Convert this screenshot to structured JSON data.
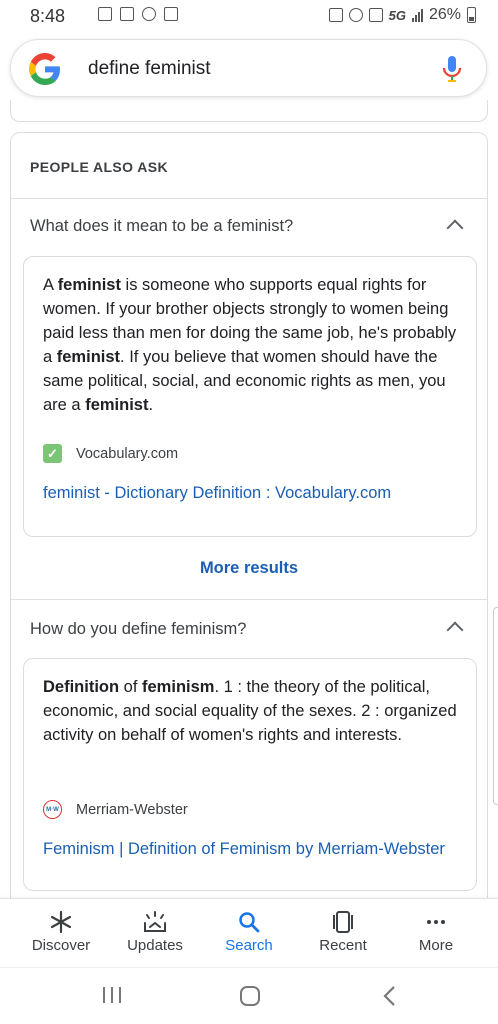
{
  "status_bar": {
    "time": "8:48",
    "network": "5G",
    "battery": "26%"
  },
  "search": {
    "query": "define feminist"
  },
  "paa": {
    "heading": "PEOPLE ALSO ASK",
    "questions": [
      {
        "question": "What does it mean to be a feminist?",
        "answer_parts": [
          {
            "t": "A ",
            "b": false
          },
          {
            "t": "feminist",
            "b": true
          },
          {
            "t": " is someone who supports equal rights for women. If your brother objects strongly to women being paid less than men for doing the same job, he's probably a ",
            "b": false
          },
          {
            "t": "feminist",
            "b": true
          },
          {
            "t": ". If you believe that women should have the same political, social, and economic rights as men, you are a ",
            "b": false
          },
          {
            "t": "feminist",
            "b": true
          },
          {
            "t": ".",
            "b": false
          }
        ],
        "source": "Vocabulary.com",
        "link": "feminist - Dictionary Definition : Vocabulary.com"
      },
      {
        "question": "How do you define feminism?",
        "answer_parts": [
          {
            "t": "Definition",
            "b": true
          },
          {
            "t": " of ",
            "b": false
          },
          {
            "t": "feminism",
            "b": true
          },
          {
            "t": ". 1 : the theory of the political, economic, and social equality of the sexes. 2 : organized activity on behalf of women's rights and interests.",
            "b": false
          }
        ],
        "source": "Merriam-Webster",
        "link": "Feminism | Definition of Feminism by Merriam-Webster"
      }
    ],
    "more_results": "More results"
  },
  "bottom_nav": [
    {
      "label": "Discover",
      "icon": "asterisk-icon",
      "active": false
    },
    {
      "label": "Updates",
      "icon": "updates-icon",
      "active": false
    },
    {
      "label": "Search",
      "icon": "search-icon",
      "active": true
    },
    {
      "label": "Recent",
      "icon": "recent-icon",
      "active": false
    },
    {
      "label": "More",
      "icon": "more-dots-icon",
      "active": false
    }
  ],
  "colors": {
    "link": "#1a5fb4",
    "active": "#1a73e8",
    "border": "#dadce0"
  }
}
